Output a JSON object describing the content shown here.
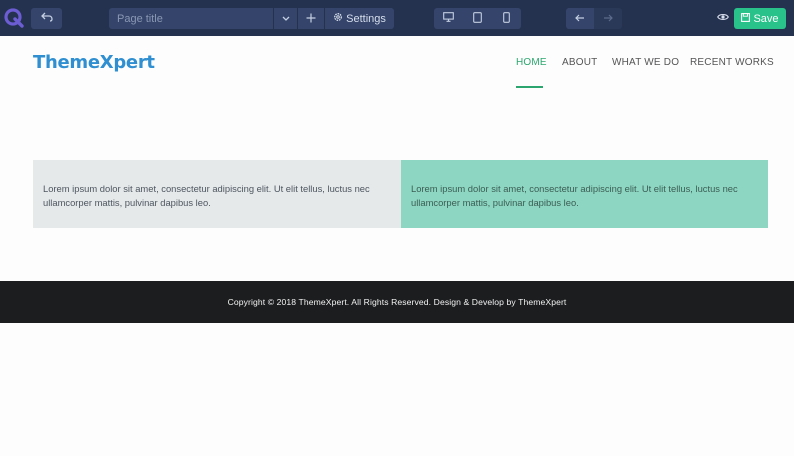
{
  "editor": {
    "title_placeholder": "Page title",
    "settings_label": "Settings",
    "save_label": "Save",
    "icons": {
      "logo": "q-logo-icon",
      "undo": "undo-icon",
      "dropdown": "chevron-down-icon",
      "add": "plus-icon",
      "settings": "gear-icon",
      "desktop": "desktop-icon",
      "tablet": "tablet-icon",
      "mobile": "mobile-icon",
      "back": "arrow-left-icon",
      "forward": "arrow-right-icon",
      "preview": "eye-icon",
      "save": "save-icon"
    },
    "colors": {
      "toolbar_bg": "#24314f",
      "button_bg": "#34446b",
      "save_bg": "#28c28a",
      "logo_accent": "#6c5dd3"
    }
  },
  "site": {
    "logo_text": "ThemeXpert",
    "nav": [
      {
        "label": "HOME",
        "active": true
      },
      {
        "label": "ABOUT",
        "active": false
      },
      {
        "label": "WHAT WE DO",
        "active": false
      },
      {
        "label": "RECENT WORKS",
        "active": false
      }
    ],
    "boxes": [
      {
        "text": "Lorem ipsum dolor sit amet, consectetur adipiscing elit. Ut elit tellus, luctus nec ullamcorper mattis, pulvinar dapibus leo.",
        "bg": "#e5e9ea"
      },
      {
        "text": "Lorem ipsum dolor sit amet, consectetur adipiscing elit. Ut elit tellus, luctus nec ullamcorper mattis, pulvinar dapibus leo.",
        "bg": "#8dd7c2"
      }
    ],
    "footer_text": "Copyright © 2018 ThemeXpert. All Rights Reserved. Design & Develop by ThemeXpert",
    "colors": {
      "brand": "#2f8fd0",
      "accent": "#2ca66e",
      "footer_bg": "#1c1d1f"
    }
  }
}
